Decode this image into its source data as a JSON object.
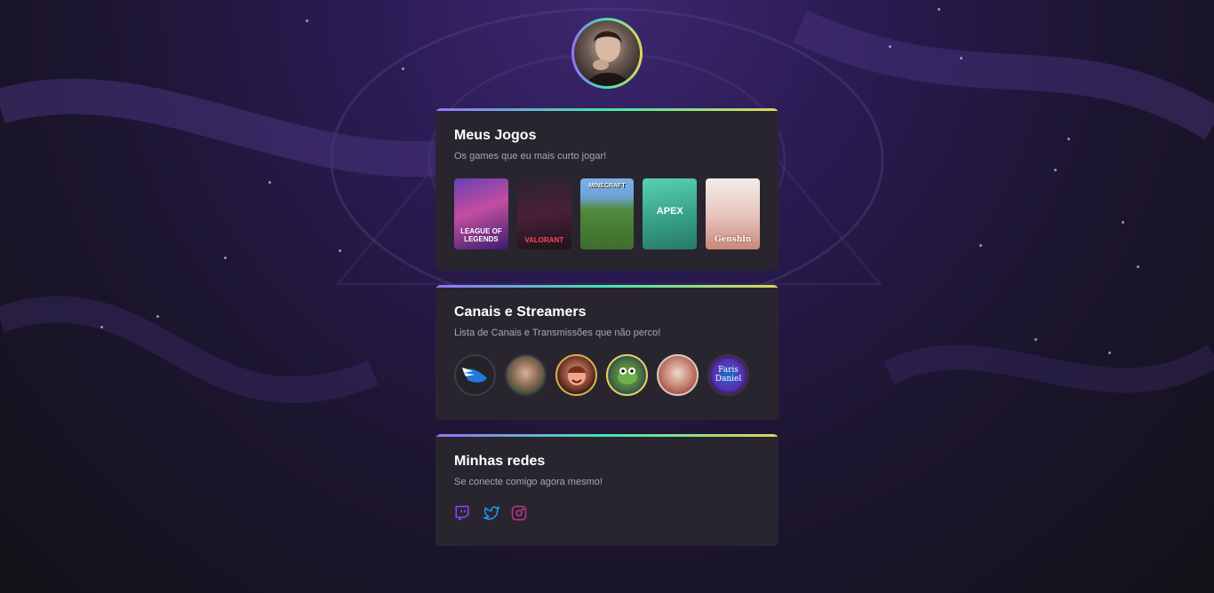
{
  "profile": {
    "avatar_alt": "profile-photo"
  },
  "games_card": {
    "title": "Meus Jogos",
    "subtitle": "Os games que eu mais curto jogar!",
    "games": [
      {
        "label": "LEAGUE OF LEGENDS"
      },
      {
        "label": "VALORANT"
      },
      {
        "label": "MINECRAFT"
      },
      {
        "label": "APEX"
      },
      {
        "label": "Genshin"
      }
    ]
  },
  "streamers_card": {
    "title": "Canais e Streamers",
    "subtitle": "Lista de Canais e Transmissões que não perco!",
    "streamers": [
      {
        "label": ""
      },
      {
        "label": ""
      },
      {
        "label": ""
      },
      {
        "label": ""
      },
      {
        "label": ""
      },
      {
        "label": "Faris Daniel"
      }
    ]
  },
  "social_card": {
    "title": "Minhas redes",
    "subtitle": "Se conecte comigo agora mesmo!",
    "icons": [
      "twitch-icon",
      "twitter-icon",
      "instagram-icon"
    ]
  },
  "colors": {
    "accent_gradient": [
      "#9572fc",
      "#43e7ad",
      "#e2d45c"
    ],
    "card_bg": "#29252f",
    "twitch": "#9146ff",
    "twitter": "#1d9bf0",
    "instagram": "#c13584"
  }
}
